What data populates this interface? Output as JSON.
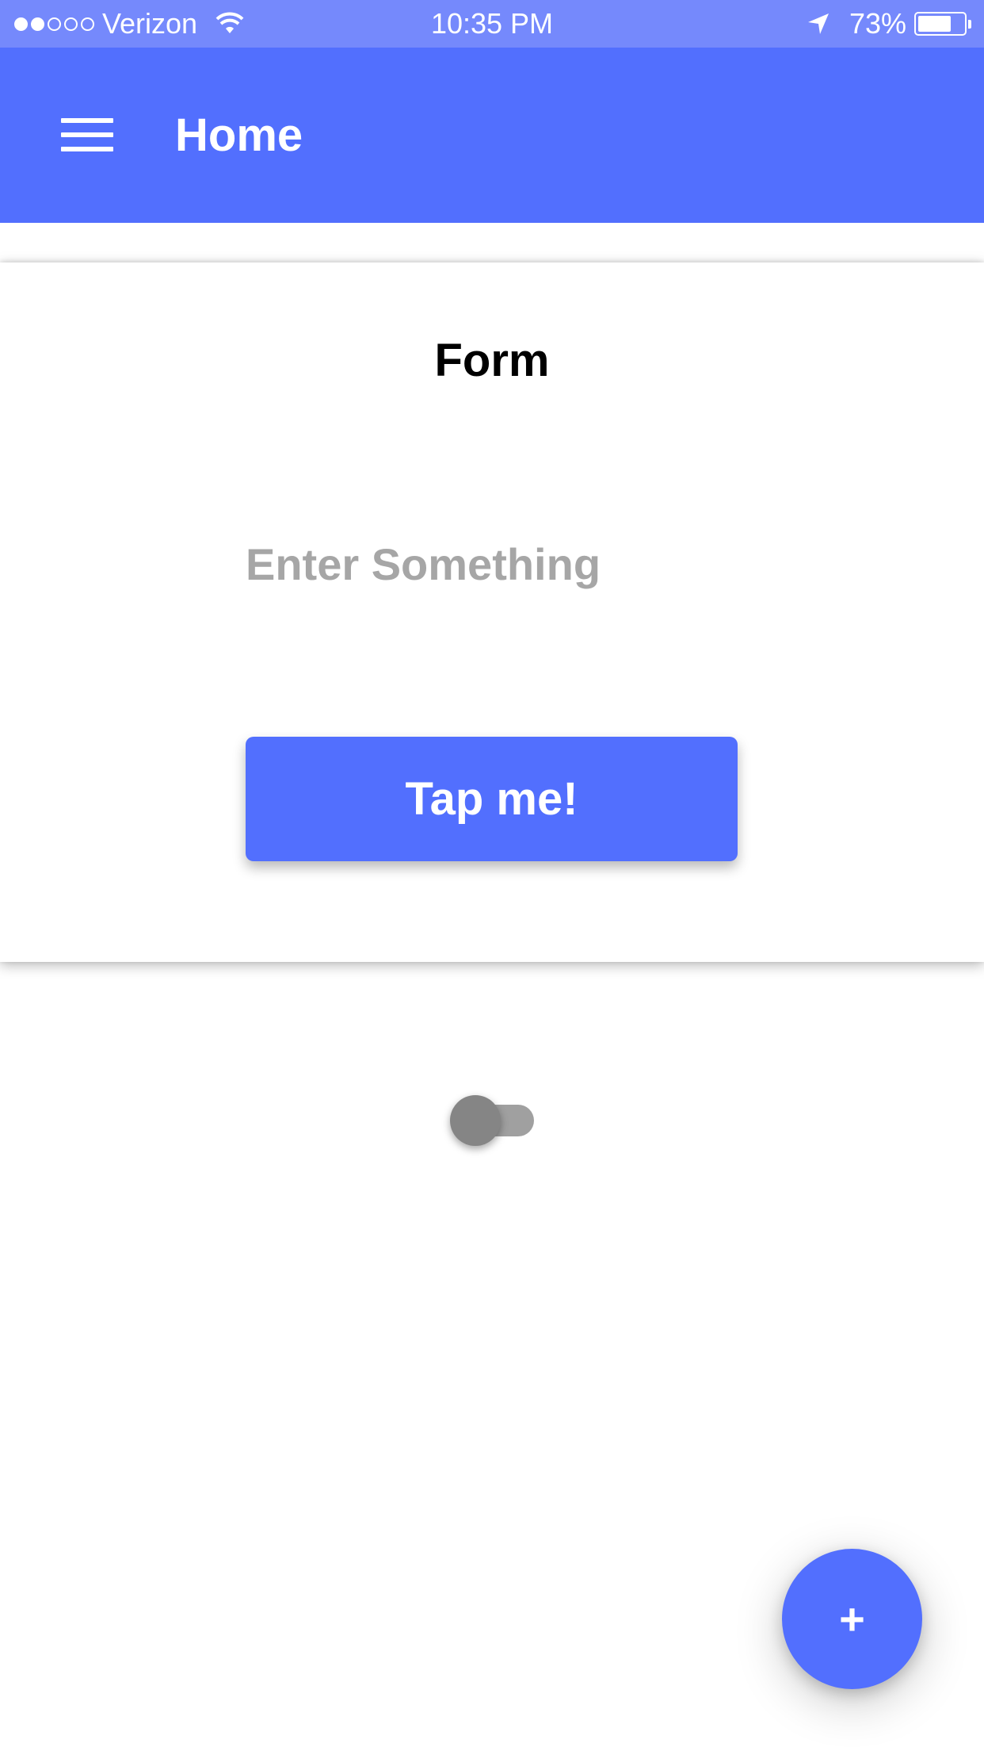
{
  "status_bar": {
    "signal_filled_dots": 2,
    "signal_total_dots": 5,
    "carrier": "Verizon",
    "time": "10:35 PM",
    "battery_percent": "73%",
    "battery_level": 0.73,
    "icons": [
      "wifi-icon",
      "location-arrow-icon",
      "battery-icon"
    ]
  },
  "app_bar": {
    "title": "Home",
    "menu_icon": "hamburger-menu-icon",
    "background_color": "#526ffe"
  },
  "form": {
    "title": "Form",
    "input": {
      "value": "",
      "placeholder": "Enter Something"
    },
    "button_label": "Tap me!"
  },
  "toggle": {
    "on": false
  },
  "fab": {
    "label": "+",
    "icon": "plus-icon"
  },
  "colors": {
    "accent": "#526ffe",
    "status_bar": "#7589fc"
  }
}
